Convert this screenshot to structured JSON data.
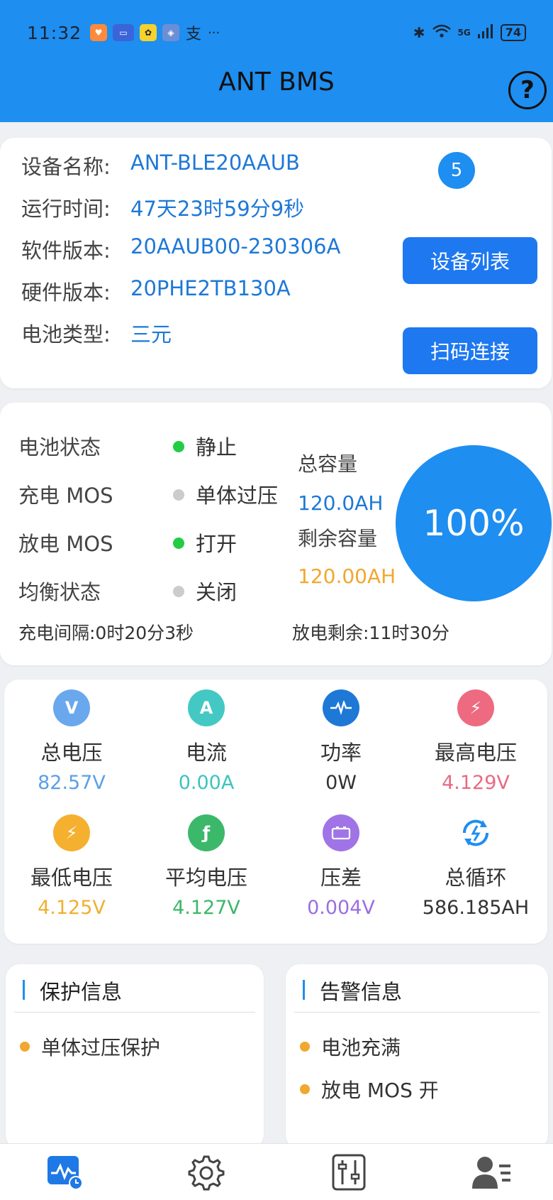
{
  "statusbar": {
    "time": "11:32",
    "signal_text": "5G",
    "battery_level": "74",
    "more": "···",
    "app_icons": [
      "health-app",
      "honor-app",
      "game-app",
      "shield-app",
      "alipay-app"
    ]
  },
  "header": {
    "title": "ANT BMS",
    "help": "?"
  },
  "device": {
    "rows": [
      {
        "label": "设备名称:",
        "value": "ANT-BLE20AAUB"
      },
      {
        "label": "运行时间:",
        "value": "47天23时59分9秒"
      },
      {
        "label": "软件版本:",
        "value": "20AAUB00-230306A"
      },
      {
        "label": "硬件版本:",
        "value": "20PHE2TB130A"
      },
      {
        "label": "电池类型:",
        "value": "三元"
      }
    ],
    "badge": "5",
    "device_list_button": "设备列表",
    "scan_connect_button": "扫码连接"
  },
  "battery_status": {
    "rows": [
      {
        "label": "电池状态",
        "value": "静止",
        "dot_color": "#22cc44"
      },
      {
        "label": "充电 MOS",
        "value": "单体过压",
        "dot_color": "#cccccc"
      },
      {
        "label": "放电 MOS",
        "value": "打开",
        "dot_color": "#22cc44"
      },
      {
        "label": "均衡状态",
        "value": "关闭",
        "dot_color": "#cccccc"
      }
    ],
    "total_capacity_label": "总容量",
    "total_capacity_value": "120.0AH",
    "remaining_capacity_label": "剩余容量",
    "remaining_capacity_value": "120.00AH",
    "soc": "100%",
    "charge_interval": "充电间隔:0时20分3秒",
    "discharge_remaining": "放电剩余:11时30分"
  },
  "metrics": [
    {
      "label": "总电压",
      "value": "82.57V",
      "color": "#5aa0e6",
      "icon": "voltage-gauge-icon"
    },
    {
      "label": "电流",
      "value": "0.00A",
      "color": "#3cc4c0",
      "icon": "ampere-gauge-icon"
    },
    {
      "label": "功率",
      "value": "0W",
      "color": "#1e78d6",
      "icon": "power-pulse-icon"
    },
    {
      "label": "最高电压",
      "value": "4.129V",
      "color": "#e86a82",
      "icon": "max-voltage-icon"
    },
    {
      "label": "最低电压",
      "value": "4.125V",
      "color": "#f0b030",
      "icon": "min-voltage-icon"
    },
    {
      "label": "平均电压",
      "value": "4.127V",
      "color": "#3cb86a",
      "icon": "average-voltage-icon"
    },
    {
      "label": "压差",
      "value": "0.004V",
      "color": "#9b6ee0",
      "icon": "battery-diff-icon"
    },
    {
      "label": "总循环",
      "value": "586.185AH",
      "color": "#1e8ef0",
      "icon": "cycle-icon"
    }
  ],
  "protection": {
    "title": "保护信息",
    "items": [
      "单体过压保护"
    ]
  },
  "alarm": {
    "title": "告警信息",
    "items": [
      "电池充满",
      "放电 MOS 开"
    ]
  },
  "nav": [
    "monitor-icon",
    "settings-gear-icon",
    "parameters-sliders-icon",
    "user-profile-icon"
  ]
}
